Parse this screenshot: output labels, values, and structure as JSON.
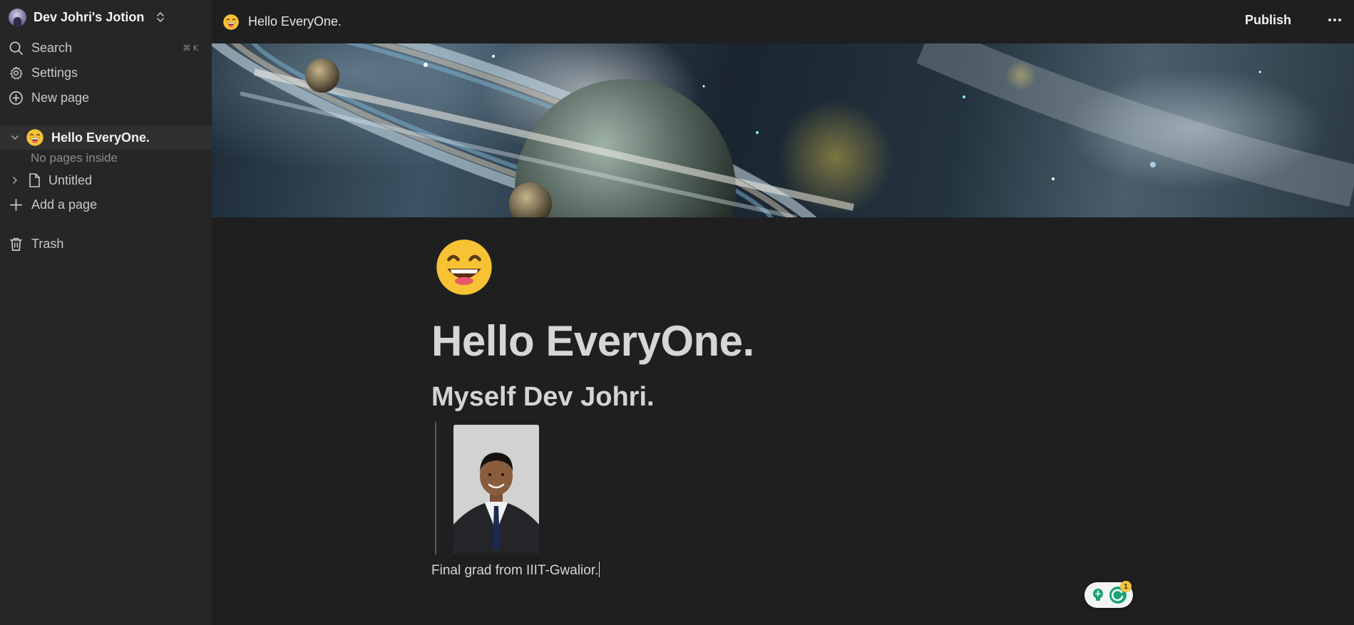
{
  "sidebar": {
    "workspace_name": "Dev Johri's Jotion",
    "nav": {
      "search_label": "Search",
      "search_shortcut": "⌘ K",
      "settings_label": "Settings",
      "new_page_label": "New page"
    },
    "pages": {
      "active_label": "Hello EveryOne.",
      "empty_note": "No pages inside",
      "untitled_label": "Untitled"
    },
    "add_page_label": "Add a page",
    "trash_label": "Trash"
  },
  "topbar": {
    "breadcrumb": "Hello EveryOne.",
    "publish_label": "Publish"
  },
  "document": {
    "title": "Hello EveryOne.",
    "heading": "Myself Dev Johri.",
    "caption": "Final grad from IIIT-Gwalior."
  },
  "widget": {
    "badge_count": "1"
  },
  "colors": {
    "app_bg": "#1f1f1f",
    "sidebar_bg": "#262626",
    "active_row_bg": "#303030",
    "widget_green": "#1aa37a",
    "badge_yellow": "#f5c242"
  },
  "icons": {
    "search": "search-icon",
    "settings": "gear-icon",
    "new_page": "plus-circle-icon",
    "add_page": "plus-icon",
    "trash": "trash-icon",
    "page": "document-icon",
    "emoji": "grinning-face-icon"
  }
}
